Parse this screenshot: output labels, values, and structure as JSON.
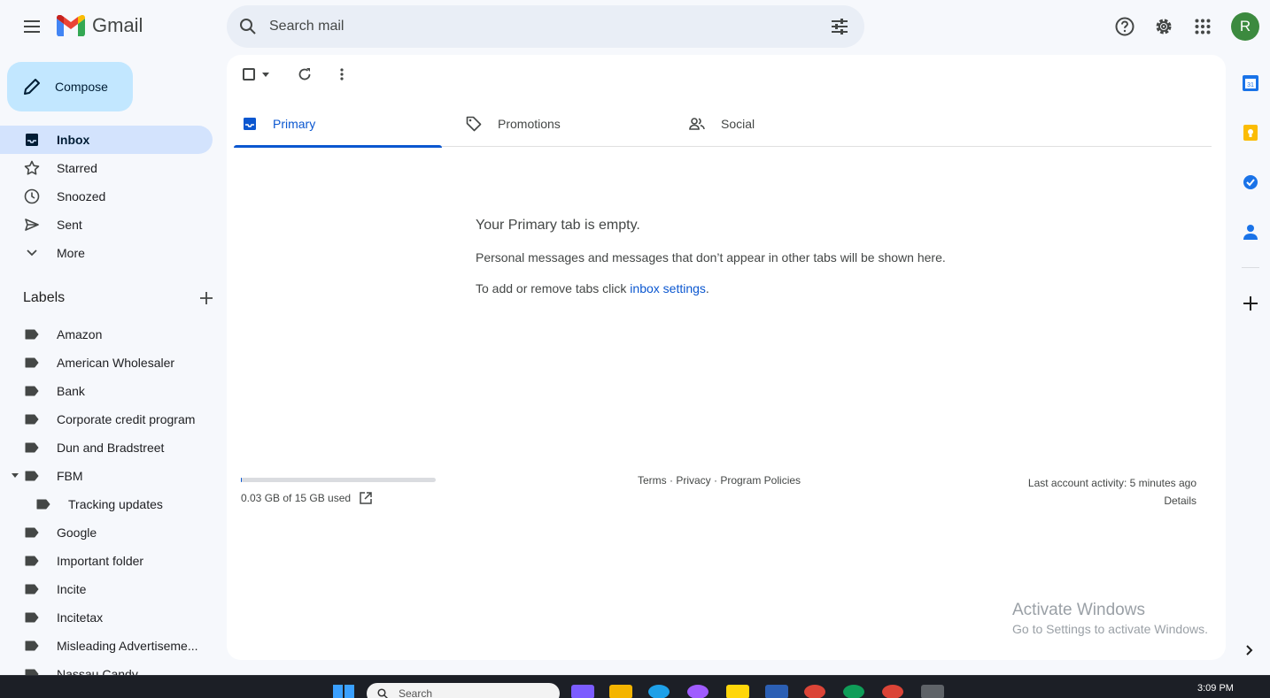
{
  "header": {
    "app_name": "Gmail",
    "search_placeholder": "Search mail",
    "avatar_letter": "R"
  },
  "compose_label": "Compose",
  "nav": [
    {
      "label": "Inbox",
      "icon": "inbox-icon",
      "active": true
    },
    {
      "label": "Starred",
      "icon": "star-icon"
    },
    {
      "label": "Snoozed",
      "icon": "clock-icon"
    },
    {
      "label": "Sent",
      "icon": "send-icon"
    },
    {
      "label": "More",
      "icon": "chevron-down-icon"
    }
  ],
  "labels_title": "Labels",
  "labels": [
    "Amazon",
    "American Wholesaler",
    "Bank",
    "Corporate credit program",
    "Dun and Bradstreet",
    "FBM",
    "Tracking updates",
    "Google",
    "Important folder",
    "Incite",
    "Incitetax",
    "Misleading Advertiseme...",
    "Nassau Candy"
  ],
  "tabs": [
    {
      "label": "Primary",
      "active": true
    },
    {
      "label": "Promotions"
    },
    {
      "label": "Social"
    }
  ],
  "empty": {
    "title": "Your Primary tab is empty.",
    "description": "Personal messages and messages that don’t appear in other tabs will be shown here.",
    "settings_prefix": "To add or remove tabs click ",
    "settings_link": "inbox settings",
    "settings_suffix": "."
  },
  "storage": {
    "text": "0.03 GB of 15 GB used",
    "fraction": 0.002
  },
  "footer_links": "Terms · Privacy · Program Policies",
  "activity": {
    "line1": "Last account activity: 5 minutes ago",
    "line2": "Details"
  },
  "watermark": {
    "line1": "Activate Windows",
    "line2": "Go to Settings to activate Windows."
  },
  "taskbar": {
    "search_label": "Search",
    "time": "3:09 PM"
  },
  "colors": {
    "accent": "#0b57d0",
    "compose_bg": "#c2e7ff",
    "active_nav": "#d3e3fd",
    "avatar": "#3c8a3f"
  }
}
